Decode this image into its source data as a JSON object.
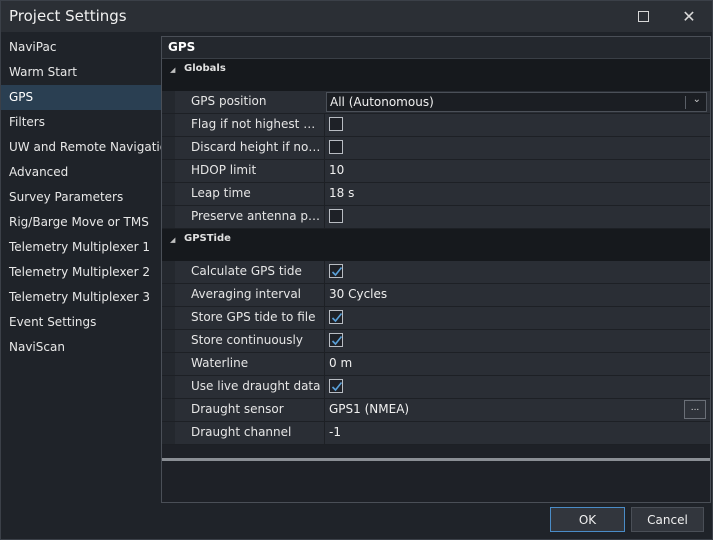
{
  "window": {
    "title": "Project Settings"
  },
  "sidebar": {
    "items": [
      {
        "label": "NaviPac"
      },
      {
        "label": "Warm Start"
      },
      {
        "label": "GPS",
        "selected": true
      },
      {
        "label": "Filters"
      },
      {
        "label": "UW and Remote Navigation"
      },
      {
        "label": "Advanced"
      },
      {
        "label": "Survey Parameters"
      },
      {
        "label": "Rig/Barge Move or TMS"
      },
      {
        "label": "Telemetry Multiplexer 1"
      },
      {
        "label": "Telemetry Multiplexer 2"
      },
      {
        "label": "Telemetry Multiplexer 3"
      },
      {
        "label": "Event Settings"
      },
      {
        "label": "NaviScan"
      }
    ]
  },
  "panel": {
    "title": "GPS",
    "globals": {
      "label": "Globals",
      "gps_position": {
        "name": "GPS position",
        "value": "All (Autonomous)"
      },
      "flag_quality": {
        "name": "Flag if not highest qua...",
        "checked": false
      },
      "discard_height": {
        "name": "Discard height if not hi...",
        "checked": false
      },
      "hdop_limit": {
        "name": "HDOP limit",
        "value": "10"
      },
      "leap_time": {
        "name": "Leap time",
        "value": "18 s"
      },
      "preserve_antenna": {
        "name": "Preserve antenna posit...",
        "checked": false
      }
    },
    "gpstide": {
      "label": "GPSTide",
      "calc_tide": {
        "name": "Calculate GPS tide",
        "checked": true
      },
      "averaging": {
        "name": "Averaging interval",
        "value": "30 Cycles"
      },
      "store_tide": {
        "name": "Store GPS tide to file",
        "checked": true
      },
      "store_cont": {
        "name": "Store continuously",
        "checked": true
      },
      "waterline": {
        "name": "Waterline",
        "value": "0 m"
      },
      "live_draught": {
        "name": "Use live draught data",
        "checked": true
      },
      "draught_sensor": {
        "name": "Draught sensor",
        "value": "GPS1 (NMEA)",
        "button": "..."
      },
      "draught_channel": {
        "name": "Draught channel",
        "value": "-1"
      }
    }
  },
  "buttons": {
    "ok": "OK",
    "cancel": "Cancel"
  },
  "colors": {
    "selected": "#2a3f52",
    "accent": "#4a8cc7",
    "check": "#5aa0d8"
  }
}
